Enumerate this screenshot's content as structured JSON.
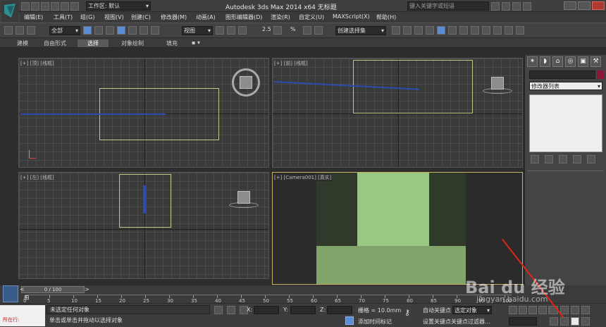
{
  "window": {
    "title": "Autodesk 3ds Max  2014 x64      无标题",
    "workspace_label": "工作区: 默认",
    "search_placeholder": "键入关键字或短语"
  },
  "menu": [
    "编辑(E)",
    "工具(T)",
    "组(G)",
    "视图(V)",
    "创建(C)",
    "修改器(M)",
    "动画(A)",
    "图形编辑器(D)",
    "渲染(R)",
    "自定义(U)",
    "MAXScript(X)",
    "帮助(H)"
  ],
  "toolbar": {
    "selection_filter": "全部",
    "reference_coord": "视图",
    "named_selection": "创建选择集",
    "snap_values": [
      "2.5",
      "%"
    ]
  },
  "ribbon": [
    "建模",
    "自由形式",
    "选择",
    "对象绘制",
    "填充"
  ],
  "viewports": {
    "top": {
      "label": "[+] [顶] [线框]"
    },
    "front": {
      "label": "[+] [前] [线框]"
    },
    "left": {
      "label": "[+] [左] [线框]"
    },
    "camera": {
      "label": "[+] [Camera001] [真实]"
    }
  },
  "command_panel": {
    "modifier_list": "修改器列表",
    "tabs": [
      "✶",
      "◗",
      "⌂",
      "◎",
      "▣",
      "⚒"
    ]
  },
  "timeline": {
    "frame_counter": "0 / 100",
    "ticks": [
      "0",
      "5",
      "10",
      "15",
      "20",
      "25",
      "30",
      "35",
      "40",
      "45",
      "50",
      "55",
      "60",
      "65",
      "70",
      "75",
      "80",
      "85",
      "90",
      "95",
      "100"
    ]
  },
  "status": {
    "maxscript_label": "所在行:",
    "selection_status": "未选定任何对象",
    "prompt": "单击或单击并拖动以选择对象",
    "x_label": "X:",
    "y_label": "Y:",
    "z_label": "Z:",
    "grid": "栅格 = 10.0mm",
    "add_time_tag": "添加时间标记",
    "auto_key": "自动关键点",
    "selected_object": "选定对象",
    "set_key": "设置关键点",
    "key_filters": "关键点过滤器..."
  },
  "watermark": {
    "brand": "Bai du 经验",
    "url": "jingyan.baidu.com"
  },
  "colors": {
    "accent_red": "#e0261a",
    "camera_green": "#9bc784",
    "wall_dark": "#2f3a2b",
    "selection_blue": "#2d4bb0"
  }
}
